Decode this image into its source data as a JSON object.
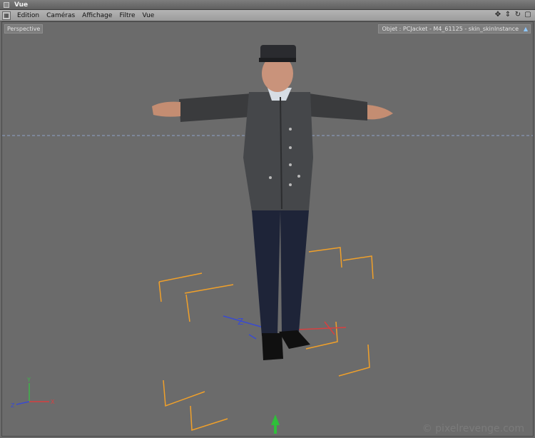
{
  "window": {
    "title": "Vue"
  },
  "menubar": {
    "items": [
      {
        "label": "Edition",
        "name": "menu-edition"
      },
      {
        "label": "Caméras",
        "name": "menu-cameras"
      },
      {
        "label": "Affichage",
        "name": "menu-affichage"
      },
      {
        "label": "Filtre",
        "name": "menu-filtre"
      },
      {
        "label": "Vue",
        "name": "menu-vue"
      }
    ],
    "nav_icons": [
      "move-icon",
      "dolly-icon",
      "rotate-icon",
      "maximize-icon"
    ]
  },
  "viewport": {
    "camera_label": "Perspective",
    "object_label": "Objet : PCJacket - M4_61125 - skin_skinInstance",
    "watermark": "© pixelrevenge.com",
    "axis_labels": {
      "x": "X",
      "y": "Y",
      "z": "Z"
    },
    "colors": {
      "background": "#6b6b6b",
      "horizon": "#8fa0c8",
      "bbox": "#f0a02a",
      "axis_x": "#d84040",
      "axis_y": "#3fb54a",
      "axis_z": "#3a4bd0"
    }
  }
}
